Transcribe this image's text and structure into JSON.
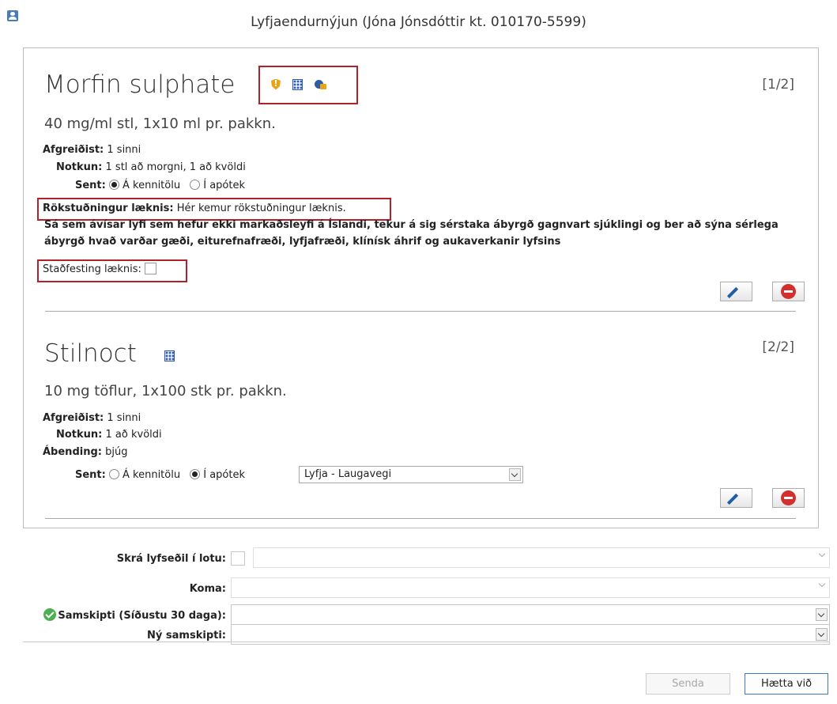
{
  "window": {
    "title": "Lyfjaendurnýjun (Jóna Jónsdóttir kt. 010170-5599)",
    "app_icon": "user-card-icon"
  },
  "items": [
    {
      "name": "Morfin sulphate",
      "count": "[1/2]",
      "strength": "40 mg/ml stl, 1x10 ml pr. pakkn.",
      "icons": [
        "shield-warning-icon",
        "pill-grid-icon",
        "lock-icon"
      ],
      "afgreidist_label": "Afgreiðist:",
      "afgreidist_value": "1 sinni",
      "notkun_label": "Notkun:",
      "notkun_value": "1 stl að morgni, 1 að kvöldi",
      "sent_label": "Sent:",
      "sent_options": [
        "Á kennitölu",
        "Í apótek"
      ],
      "sent_selected": "Á kennitölu",
      "rokstudningur_label": "Rökstuðningur læknis:",
      "rokstudningur_value": "Hér kemur rökstuðningur læknis.",
      "warning": "Sá sem ávísar lyfi sem hefur ekki markaðsleyfi á Íslandi, tekur á sig sérstaka ábyrgð gagnvart sjúklingi og ber að sýna sérlega ábyrgð hvað varðar gæði, eiturefnafræði, lyfjafræði, klínísk áhrif og aukaverkanir lyfsins",
      "stadfesting_label": "Staðfesting læknis:"
    },
    {
      "name": "Stilnoct",
      "count": "[2/2]",
      "strength": "10 mg töflur, 1x100 stk pr. pakkn.",
      "icons": [
        "pill-grid-icon"
      ],
      "afgreidist_label": "Afgreiðist:",
      "afgreidist_value": "1 sinni",
      "notkun_label": "Notkun:",
      "notkun_value": "1 að kvöldi",
      "abending_label": "Ábending:",
      "abending_value": "bjúg",
      "sent_label": "Sent:",
      "sent_options": [
        "Á kennitölu",
        "Í apótek"
      ],
      "sent_selected": "Í apótek",
      "pharmacy": "Lyfja - Laugavegi"
    }
  ],
  "form": {
    "lota_label": "Skrá lyfseðil í lotu:",
    "koma_label": "Koma:",
    "samskipti_label": "Samskipti (Síðustu 30 daga):",
    "ny_samskipti_label": "Ný samskipti:"
  },
  "buttons": {
    "senda": "Senda",
    "haetta": "Hætta við"
  },
  "colors": {
    "highlight": "#b3222a",
    "accent": "#3c78c3",
    "warning_icon": "#e8a317"
  }
}
